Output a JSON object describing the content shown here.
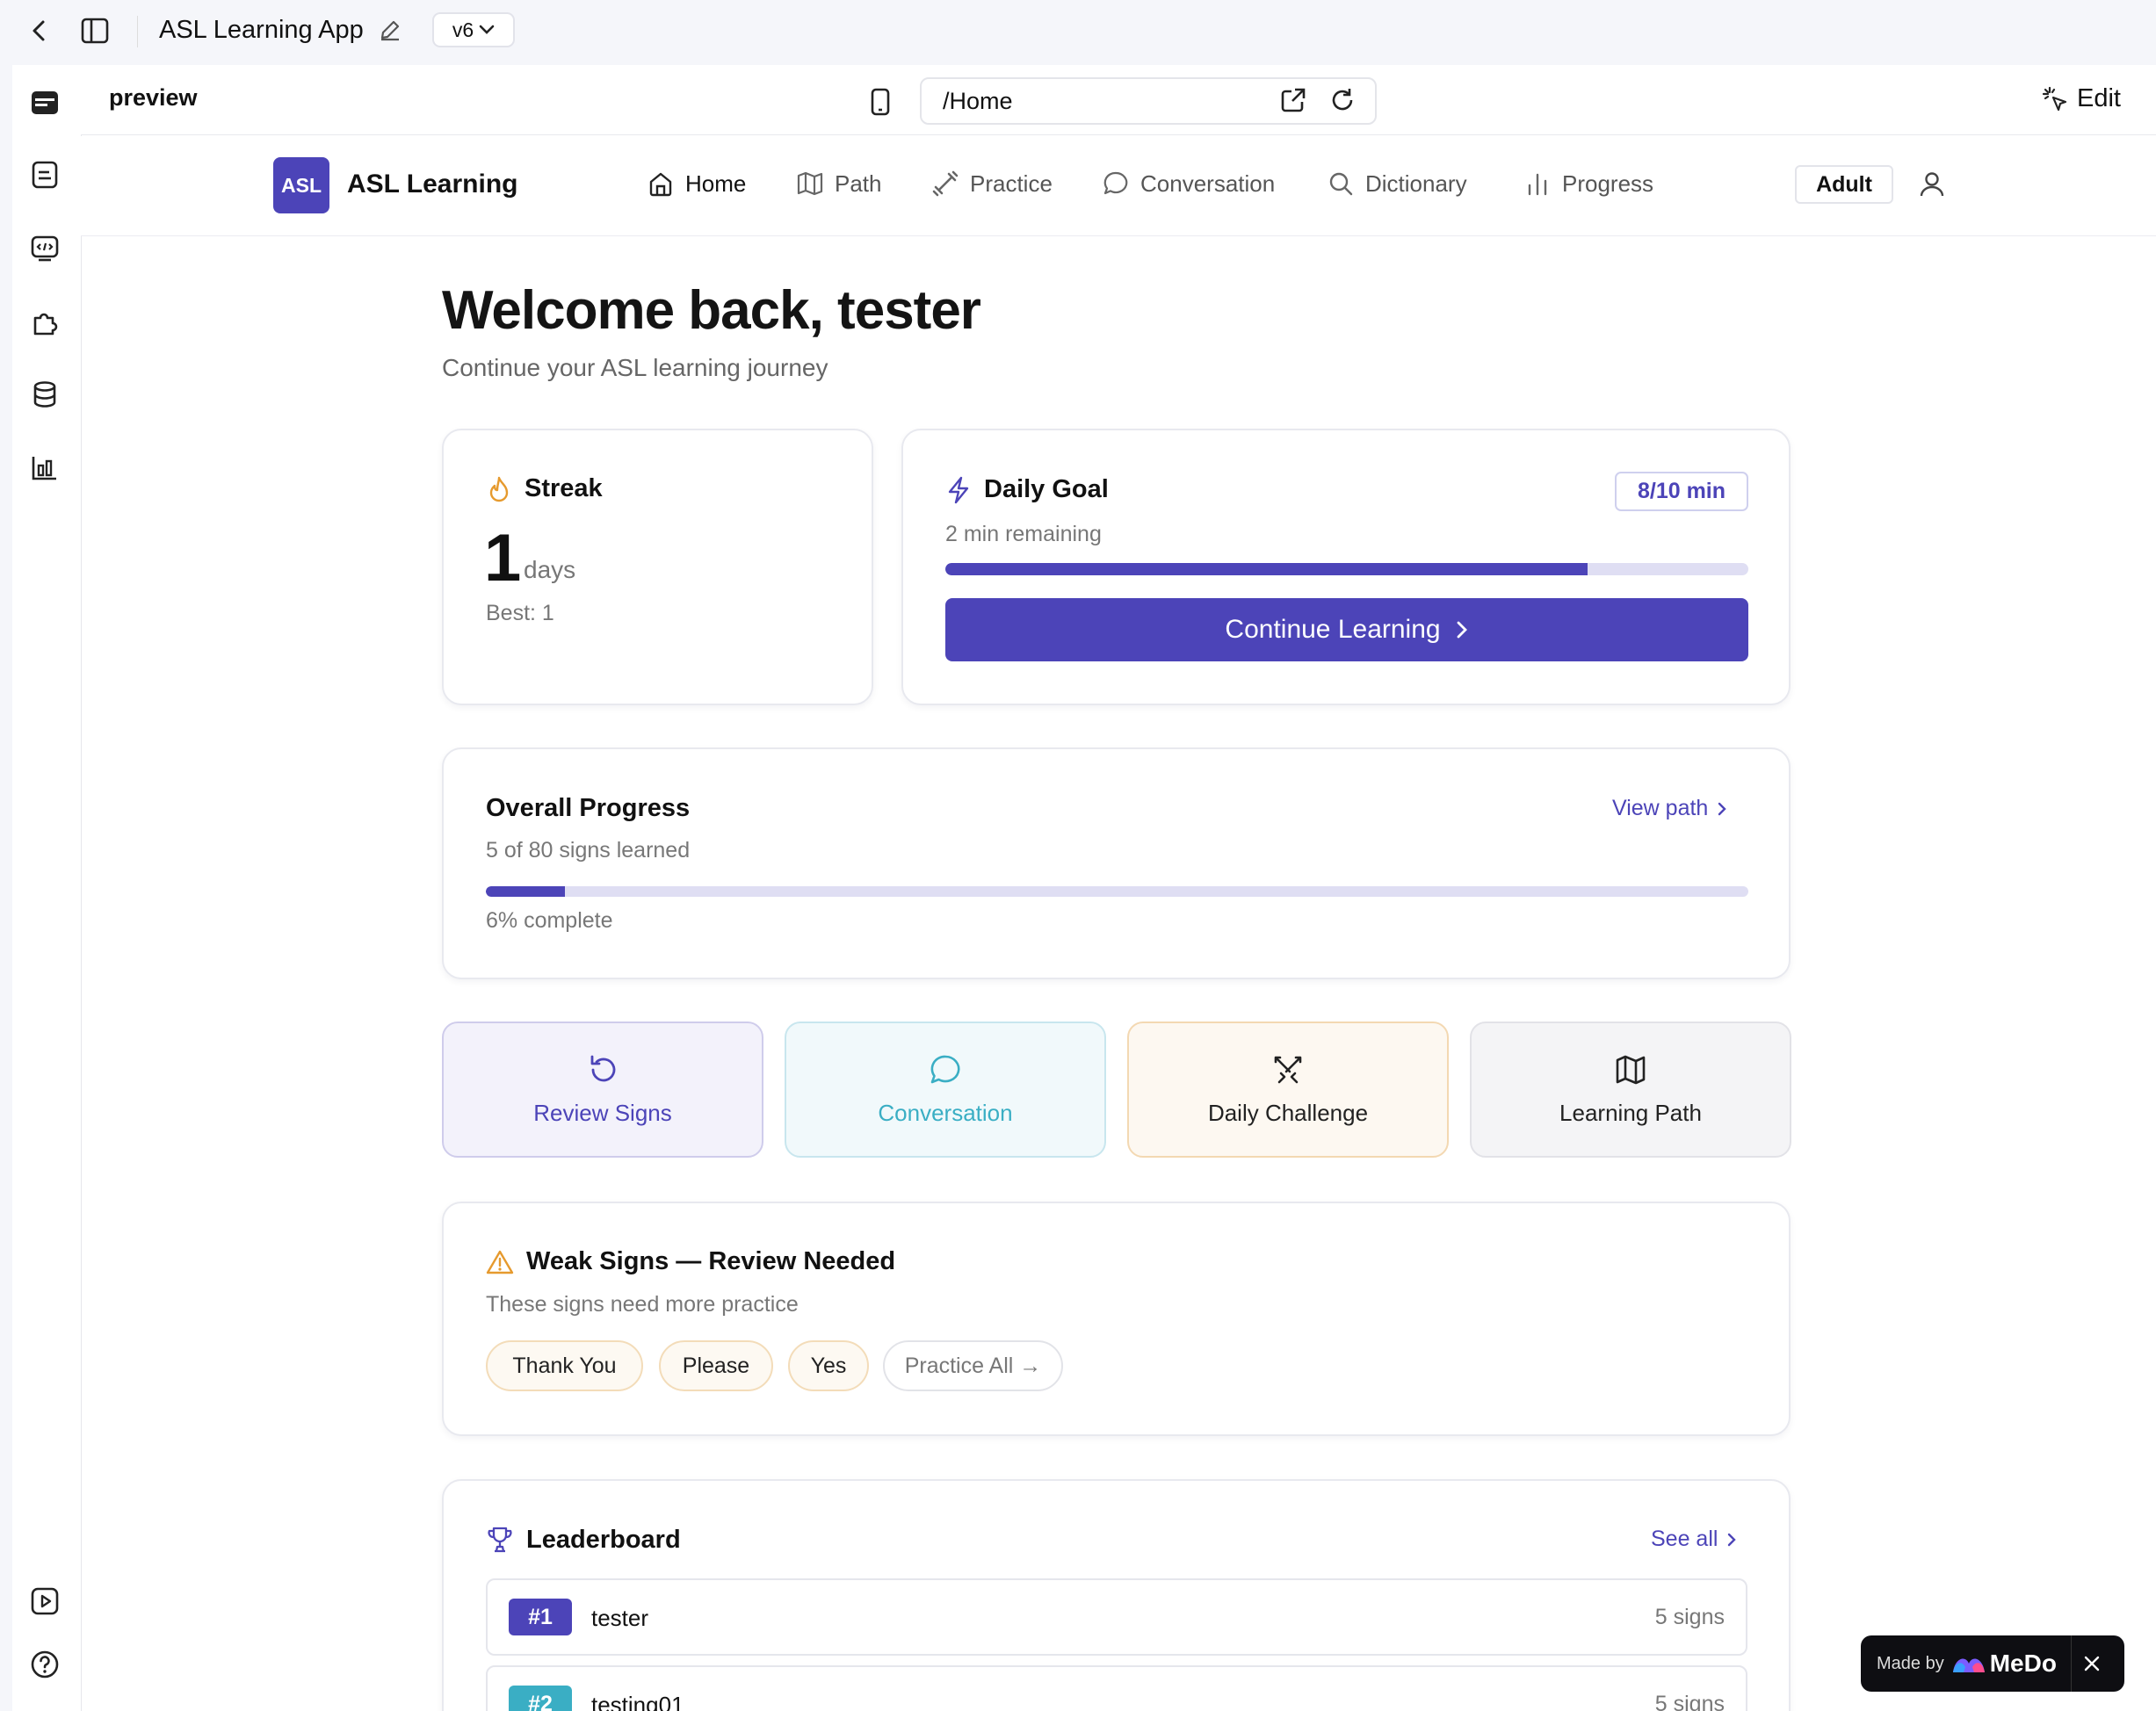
{
  "editor": {
    "app_title": "ASL Learning App",
    "version": "v6",
    "preview_label": "preview",
    "url": "/Home",
    "edit_label": "Edit"
  },
  "nav": {
    "logo_text": "ASL",
    "brand": "ASL Learning",
    "items": [
      {
        "label": "Home",
        "icon": "home-icon"
      },
      {
        "label": "Path",
        "icon": "map-icon"
      },
      {
        "label": "Practice",
        "icon": "dumbbell-icon"
      },
      {
        "label": "Conversation",
        "icon": "chat-icon"
      },
      {
        "label": "Dictionary",
        "icon": "search-icon"
      },
      {
        "label": "Progress",
        "icon": "bar-chart-icon"
      }
    ],
    "mode": "Adult"
  },
  "welcome": {
    "title": "Welcome back, tester",
    "subtitle": "Continue your ASL learning journey"
  },
  "streak": {
    "title": "Streak",
    "count": "1",
    "unit": "days",
    "best": "Best: 1"
  },
  "daily_goal": {
    "title": "Daily Goal",
    "badge": "8/10 min",
    "remaining": "2 min remaining",
    "progress": 0.8,
    "button": "Continue Learning"
  },
  "overall": {
    "title": "Overall Progress",
    "link": "View path",
    "learned": "5 of 80 signs learned",
    "progress": 0.0625,
    "complete": "6% complete"
  },
  "tiles": [
    {
      "label": "Review Signs",
      "icon": "rotate-ccw-icon"
    },
    {
      "label": "Conversation",
      "icon": "chat-icon"
    },
    {
      "label": "Daily Challenge",
      "icon": "swords-icon"
    },
    {
      "label": "Learning Path",
      "icon": "map-icon"
    }
  ],
  "weak": {
    "title": "Weak Signs — Review Needed",
    "subtitle": "These signs need more practice",
    "chips": [
      "Thank You",
      "Please",
      "Yes"
    ],
    "practice_all": "Practice All →"
  },
  "leaderboard": {
    "title": "Leaderboard",
    "link": "See all",
    "rows": [
      {
        "rank": "#1",
        "name": "tester",
        "value": "5 signs"
      },
      {
        "rank": "#2",
        "name": "testing01",
        "value": "5 signs"
      }
    ]
  },
  "made_by": {
    "prefix": "Made by",
    "brand": "MeDo"
  },
  "colors": {
    "accent": "#4c44b8",
    "orange": "#e69a2e",
    "teal": "#3aaec4"
  }
}
